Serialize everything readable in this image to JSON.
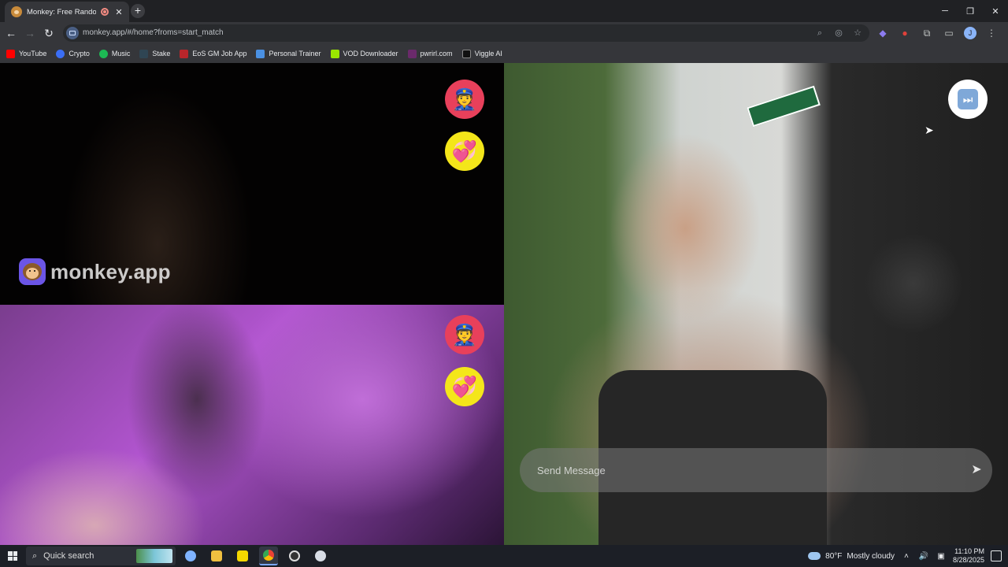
{
  "browser": {
    "tab": {
      "title": "Monkey: Free Random Video Chat",
      "close": "✕"
    },
    "new_tab": "+",
    "window_controls": {
      "minimize": "─",
      "restore": "❐",
      "close": "✕"
    },
    "nav": {
      "back": "←",
      "forward": "→",
      "reload": "↻"
    },
    "address_bar": {
      "url": "monkey.app/#/home?froms=start_match"
    },
    "omnibox_icons": [
      "zoom-icon",
      "eye-off-icon",
      "star-icon"
    ],
    "extensions": [
      "extension-purple-icon",
      "extension-red-icon",
      "puzzle-icon",
      "sidepanel-icon"
    ],
    "profile_initial": "J",
    "menu": "⋮"
  },
  "bookmarks": [
    {
      "label": "YouTube",
      "color": "#ff0000"
    },
    {
      "label": "Crypto",
      "color": "#3b6ef5"
    },
    {
      "label": "Music",
      "color": "#1db954"
    },
    {
      "label": "Stake",
      "color": "#2f4553"
    },
    {
      "label": "EoS GM Job App",
      "color": "#b8262b"
    },
    {
      "label": "Personal Trainer",
      "color": "#4a90e2"
    },
    {
      "label": "VOD Downloader",
      "color": "#9ae600"
    },
    {
      "label": "pwrirl.com",
      "color": "#6b2a6b"
    },
    {
      "label": "Viggle AI",
      "color": "#111111"
    }
  ],
  "page": {
    "brand_text": "monkey.app",
    "report_emoji": "👮",
    "like_emoji": "💞",
    "skip_icon": "⏭",
    "chat": {
      "placeholder": "Send Message",
      "send_icon": "➤"
    },
    "colors": {
      "police_button": "#e8405b",
      "heart_button": "#f4e61a",
      "logo": "#6b55e6"
    }
  },
  "taskbar": {
    "search_label": "Quick search",
    "pinned": [
      "task-view-icon",
      "file-explorer-icon",
      "sticky-notes-icon",
      "chrome-icon",
      "obs-icon",
      "app-icon"
    ],
    "weather": {
      "temp": "80°F",
      "condition": "Mostly cloudy"
    },
    "clock": {
      "time": "11:10 PM",
      "date": "8/28/2025"
    }
  }
}
